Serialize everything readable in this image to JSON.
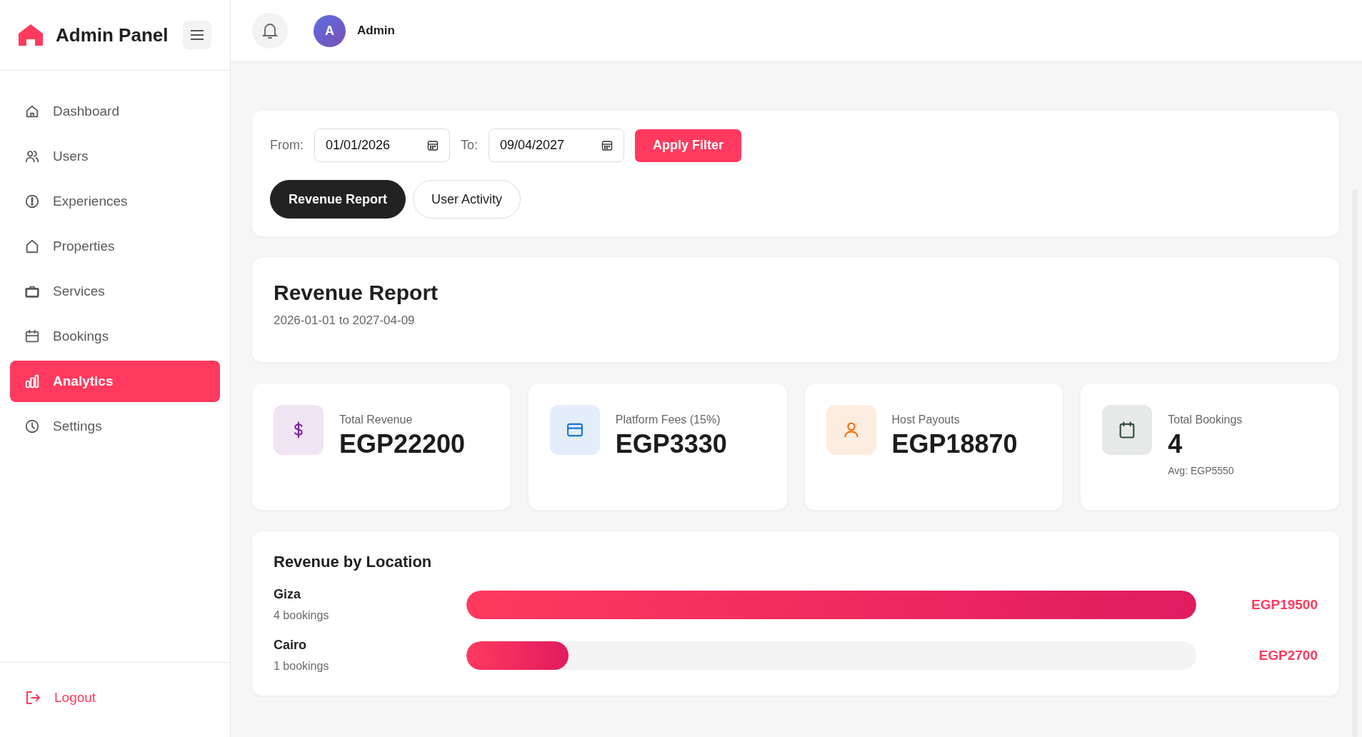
{
  "sidebar": {
    "title": "Admin Panel",
    "items": [
      {
        "label": "Dashboard",
        "selected": false
      },
      {
        "label": "Users",
        "selected": false
      },
      {
        "label": "Experiences",
        "selected": false
      },
      {
        "label": "Properties",
        "selected": false
      },
      {
        "label": "Services",
        "selected": false
      },
      {
        "label": "Bookings",
        "selected": false
      },
      {
        "label": "Analytics",
        "selected": true
      },
      {
        "label": "Settings",
        "selected": false
      }
    ],
    "logout": "Logout"
  },
  "header": {
    "avatar_initial": "A",
    "user_name": "Admin"
  },
  "filter": {
    "from_label": "From:",
    "from_value": "01/01/2026",
    "to_label": "To:",
    "to_value": "09/04/2027",
    "apply": "Apply Filter",
    "tabs": [
      {
        "label": "Revenue Report",
        "selected": true
      },
      {
        "label": "User Activity",
        "selected": false
      }
    ]
  },
  "report": {
    "title": "Revenue Report",
    "range": "2026-01-01 to 2027-04-09"
  },
  "stats": [
    {
      "label": "Total Revenue",
      "value": "EGP22200",
      "color": "#7b1fa2"
    },
    {
      "label": "Platform Fees (15%)",
      "value": "EGP3330",
      "color": "#1976d2"
    },
    {
      "label": "Host Payouts",
      "value": "EGP18870",
      "color": "#ef6c00"
    },
    {
      "label": "Total Bookings",
      "value": "4",
      "note": "Avg: EGP5550",
      "color": "#2e4a36"
    }
  ],
  "locations": {
    "title": "Revenue by Location",
    "rows": [
      {
        "name": "Giza",
        "bookings": "4 bookings",
        "level": 1.0,
        "amount": "EGP19500"
      },
      {
        "name": "Cairo",
        "bookings": "1 bookings",
        "level": 0.14,
        "amount": "EGP2700"
      }
    ]
  }
}
